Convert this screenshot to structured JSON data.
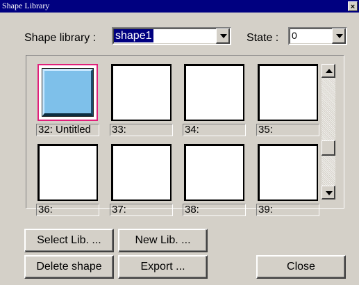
{
  "window": {
    "title": "Shape Library",
    "close_glyph": "×"
  },
  "top_row": {
    "library_label": "Shape library :",
    "library_value": "shape1",
    "state_label": "State :",
    "state_value": "0"
  },
  "shapes": [
    {
      "caption": "32: Untitled",
      "selected": true
    },
    {
      "caption": "33:",
      "selected": false
    },
    {
      "caption": "34:",
      "selected": false
    },
    {
      "caption": "35:",
      "selected": false
    },
    {
      "caption": "36:",
      "selected": false
    },
    {
      "caption": "37:",
      "selected": false
    },
    {
      "caption": "38:",
      "selected": false
    },
    {
      "caption": "39:",
      "selected": false
    }
  ],
  "buttons": {
    "select_lib": "Select Lib. ...",
    "new_lib": "New Lib. ...",
    "delete_shape": "Delete shape",
    "export": "Export ...",
    "close": "Close"
  },
  "colors": {
    "titlebar": "#000080",
    "selection_border": "#e0207a",
    "shape_fill": "#7ec0ea"
  },
  "icons": {
    "combo_arrow": "chevron-down-icon",
    "scroll_up": "arrow-up-icon",
    "scroll_down": "arrow-down-icon",
    "close": "close-icon"
  }
}
